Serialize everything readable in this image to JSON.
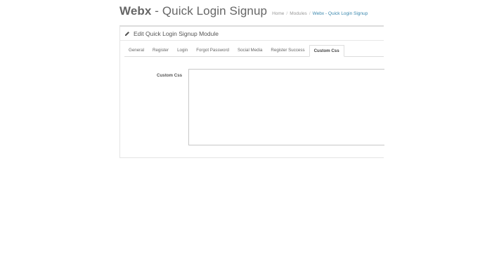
{
  "header": {
    "brand": "Webx",
    "title_rest": " - Quick Login Signup",
    "breadcrumb": [
      {
        "label": "Home"
      },
      {
        "label": "Modules"
      },
      {
        "label": "Webx - Quick Login Signup"
      }
    ],
    "breadcrumb_active_color": "#3a87ad"
  },
  "panel": {
    "heading_icon": "pencil-icon",
    "heading": "Edit Quick Login Signup Module",
    "tabs": [
      {
        "label": "General"
      },
      {
        "label": "Register"
      },
      {
        "label": "Login"
      },
      {
        "label": "Forgot Password"
      },
      {
        "label": "Social Media"
      },
      {
        "label": "Register Success"
      },
      {
        "label": "Custom Css",
        "active": true
      }
    ],
    "form": {
      "custom_css_label": "Custom Css",
      "custom_css_value": ""
    }
  }
}
